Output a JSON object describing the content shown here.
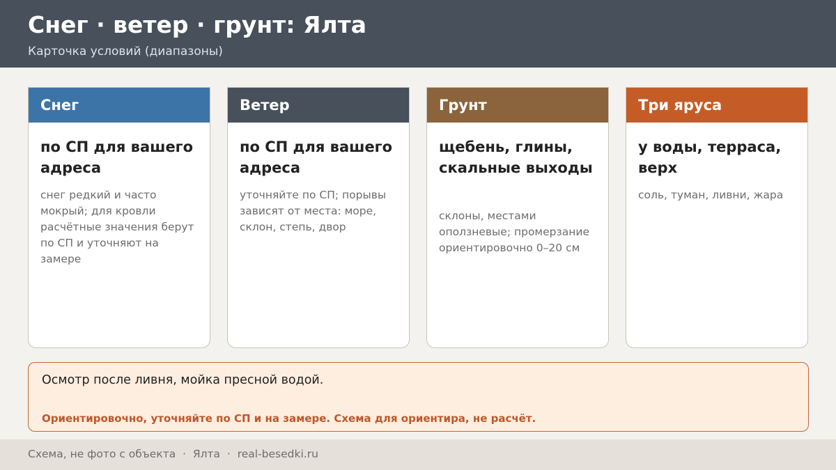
{
  "header": {
    "title": "Снег · ветер · грунт: Ялта",
    "subtitle": "Карточка условий (диапазоны)"
  },
  "cards": [
    {
      "label": "Снег",
      "color": "#3d74a8",
      "main": "по СП для вашего адреса",
      "note": "снег редкий и часто мокрый; для кровли расчётные значения берут по СП и уточняют на замере"
    },
    {
      "label": "Ветер",
      "color": "#47505b",
      "main": "по СП для вашего адреса",
      "note": "уточняйте по СП; порывы зависят от места: море, склон, степь, двор"
    },
    {
      "label": "Грунт",
      "color": "#8b643d",
      "main": "щебень, глины, скальные выходы",
      "note": "склоны, местами оползневые; промерзание ориентировочно 0–20 см"
    },
    {
      "label": "Три яруса",
      "color": "#c55c27",
      "main": "у воды, терраса, верх",
      "note": "соль, туман, ливни, жара"
    }
  ],
  "notice": {
    "text": "Осмотр после ливня, мойка пресной водой.",
    "warning": "Ориентировочно, уточняйте по СП и на замере. Схема для ориентира, не расчёт."
  },
  "footer": {
    "text": "Схема, не фото с объекта  ·  Ялта  ·  real-besedki.ru"
  }
}
